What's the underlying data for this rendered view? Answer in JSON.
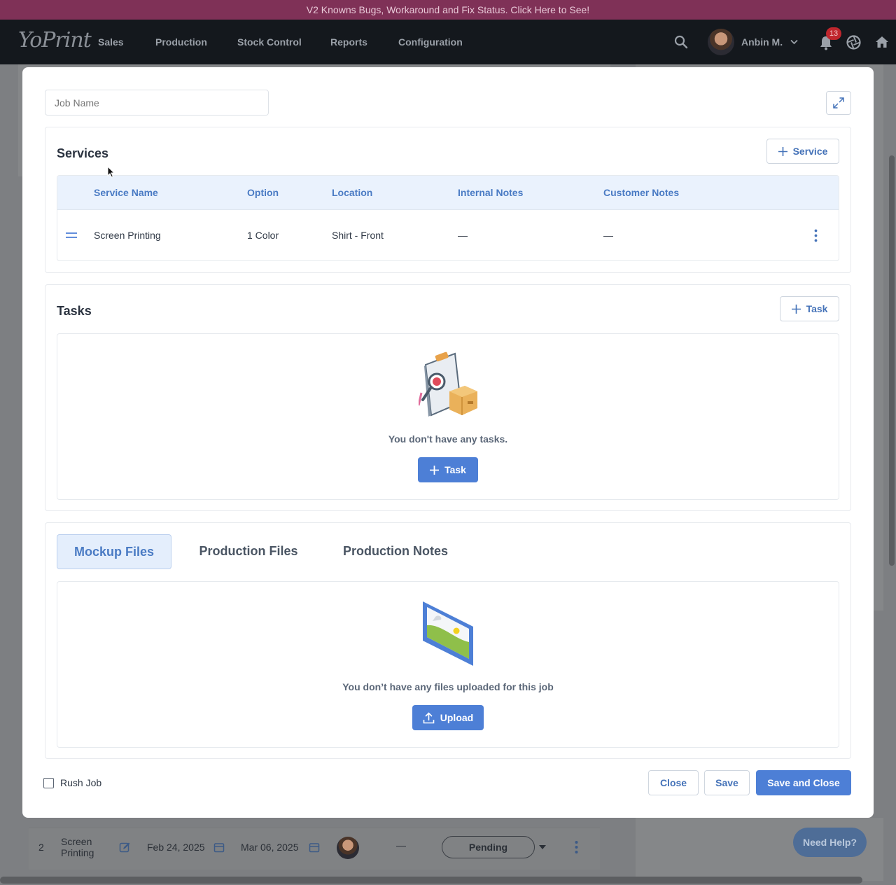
{
  "banner": {
    "text": "V2 Knowns Bugs, Workaround and Fix Status. Click Here to See!"
  },
  "nav": {
    "logo": "YoPrint",
    "items": [
      "Sales",
      "Production",
      "Stock Control",
      "Reports",
      "Configuration"
    ],
    "user_name": "Anbin M.",
    "notification_count": "13"
  },
  "modal": {
    "job_name_placeholder": "Job Name",
    "services": {
      "title": "Services",
      "add_label": "Service",
      "columns": [
        "Service Name",
        "Option",
        "Location",
        "Internal Notes",
        "Customer Notes"
      ],
      "rows": [
        {
          "service_name": "Screen Printing",
          "option": "1 Color",
          "location": "Shirt - Front",
          "internal_notes": "—",
          "customer_notes": "—"
        }
      ]
    },
    "tasks": {
      "title": "Tasks",
      "add_label": "Task",
      "empty_text": "You don't have any tasks.",
      "empty_button": "Task"
    },
    "files": {
      "tabs": [
        "Mockup Files",
        "Production Files",
        "Production Notes"
      ],
      "active_tab": "Mockup Files",
      "empty_text": "You don’t have any files uploaded for this job",
      "upload_label": "Upload"
    },
    "footer": {
      "rush_label": "Rush Job",
      "rush_checked": false,
      "close_label": "Close",
      "save_label": "Save",
      "save_close_label": "Save and Close"
    }
  },
  "background": {
    "row_number": "2",
    "row_service": "Screen Printing",
    "row_start": "Feb 24, 2025",
    "row_end": "Mar 06, 2025",
    "row_dash": "—",
    "row_status": "Pending",
    "need_help": "Need Help?"
  },
  "colors": {
    "accent": "#4d7fd6",
    "banner": "#7f3157",
    "nav": "#14181d"
  }
}
